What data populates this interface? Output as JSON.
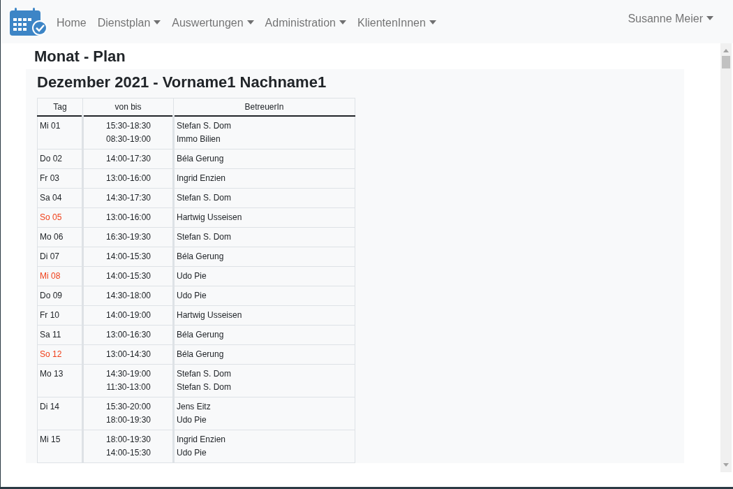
{
  "navbar": {
    "items": [
      {
        "label": "Home",
        "dropdown": false
      },
      {
        "label": "Dienstplan",
        "dropdown": true
      },
      {
        "label": "Auswertungen",
        "dropdown": true
      },
      {
        "label": "Administration",
        "dropdown": true
      },
      {
        "label": "KlientenInnen",
        "dropdown": true
      }
    ],
    "user": {
      "label": "Susanne Meier",
      "dropdown": true
    }
  },
  "page_title": "Monat - Plan",
  "plan_title": "Dezember 2021 - Vorname1 Nachname1",
  "table": {
    "columns": [
      "Tag",
      "von bis",
      "BetreuerIn"
    ],
    "rows": [
      {
        "day": "Mi 01",
        "holiday": false,
        "shifts": [
          {
            "time": "15:30-18:30",
            "carer": "Stefan S. Dom"
          },
          {
            "time": "08:30-19:00",
            "carer": "Immo Bilien"
          }
        ]
      },
      {
        "day": "Do 02",
        "holiday": false,
        "shifts": [
          {
            "time": "14:00-17:30",
            "carer": "Béla Gerung"
          }
        ]
      },
      {
        "day": "Fr 03",
        "holiday": false,
        "shifts": [
          {
            "time": "13:00-16:00",
            "carer": "Ingrid Enzien"
          }
        ]
      },
      {
        "day": "Sa 04",
        "holiday": false,
        "shifts": [
          {
            "time": "14:30-17:30",
            "carer": "Stefan S. Dom"
          }
        ]
      },
      {
        "day": "So 05",
        "holiday": true,
        "shifts": [
          {
            "time": "13:00-16:00",
            "carer": "Hartwig Usseisen"
          }
        ]
      },
      {
        "day": "Mo 06",
        "holiday": false,
        "shifts": [
          {
            "time": "16:30-19:30",
            "carer": "Stefan S. Dom"
          }
        ]
      },
      {
        "day": "Di 07",
        "holiday": false,
        "shifts": [
          {
            "time": "14:00-15:30",
            "carer": "Béla Gerung"
          }
        ]
      },
      {
        "day": "Mi 08",
        "holiday": true,
        "shifts": [
          {
            "time": "14:00-15:30",
            "carer": "Udo Pie"
          }
        ]
      },
      {
        "day": "Do 09",
        "holiday": false,
        "shifts": [
          {
            "time": "14:30-18:00",
            "carer": "Udo Pie"
          }
        ]
      },
      {
        "day": "Fr 10",
        "holiday": false,
        "shifts": [
          {
            "time": "14:00-19:00",
            "carer": "Hartwig Usseisen"
          }
        ]
      },
      {
        "day": "Sa 11",
        "holiday": false,
        "shifts": [
          {
            "time": "13:00-16:30",
            "carer": "Béla Gerung"
          }
        ]
      },
      {
        "day": "So 12",
        "holiday": true,
        "shifts": [
          {
            "time": "13:00-14:30",
            "carer": "Béla Gerung"
          }
        ]
      },
      {
        "day": "Mo 13",
        "holiday": false,
        "shifts": [
          {
            "time": "14:30-19:00",
            "carer": "Stefan S. Dom"
          },
          {
            "time": "11:30-13:00",
            "carer": "Stefan S. Dom"
          }
        ]
      },
      {
        "day": "Di 14",
        "holiday": false,
        "shifts": [
          {
            "time": "15:30-20:00",
            "carer": "Jens Eitz"
          },
          {
            "time": "18:00-19:30",
            "carer": "Udo Pie"
          }
        ]
      },
      {
        "day": "Mi 15",
        "holiday": false,
        "shifts": [
          {
            "time": "18:00-19:30",
            "carer": "Ingrid Enzien"
          },
          {
            "time": "14:00-15:30",
            "carer": "Udo Pie"
          }
        ]
      }
    ]
  }
}
